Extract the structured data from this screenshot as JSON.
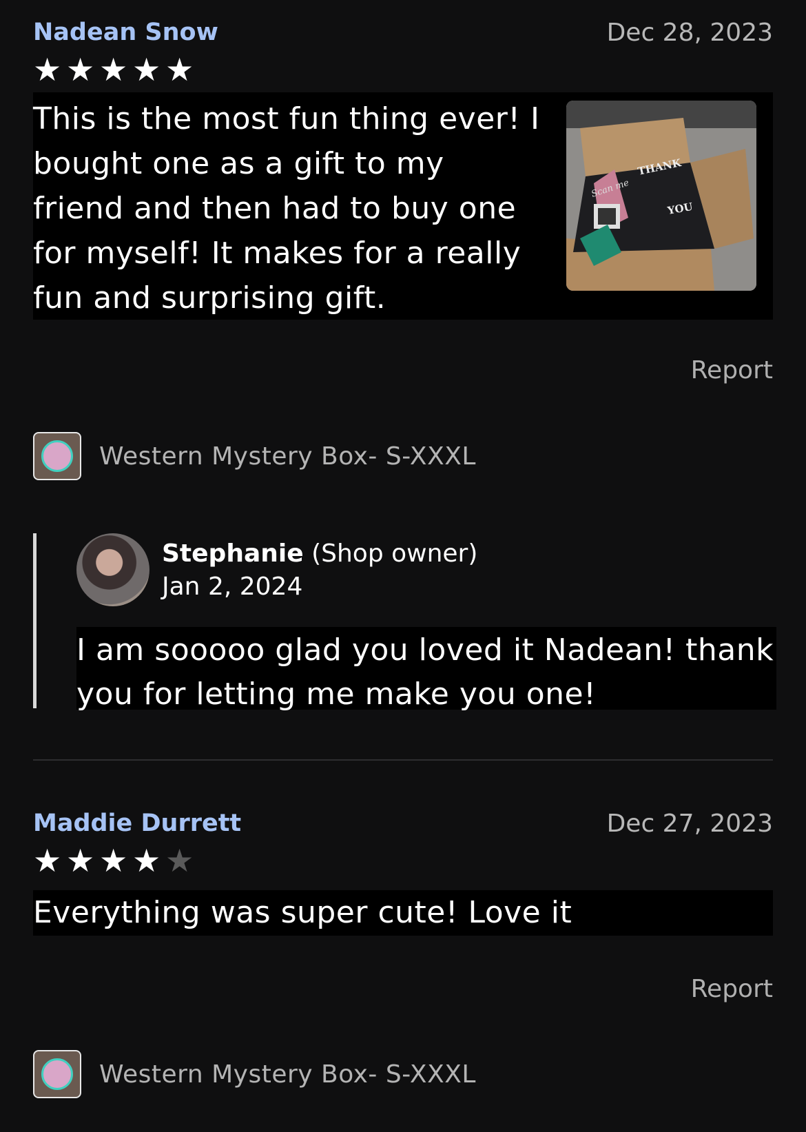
{
  "reviews": [
    {
      "reviewer": "Nadean Snow",
      "date": "Dec 28, 2023",
      "rating": 5,
      "text": "This is the most fun thing ever! I bought one as a gift to my friend and then had to buy one for myself! It makes for a really fun and surprising gift.",
      "report_label": "Report",
      "product_name": "Western Mystery Box- S-XXXL",
      "photo_text": {
        "line1": "THANK",
        "line2": "YOU",
        "scan": "Scan me"
      },
      "reply": {
        "owner_name": "Stephanie",
        "owner_role": "(Shop owner)",
        "date": "Jan 2, 2024",
        "text": "I am sooooo glad you loved it Nadean! thank you for letting me make you one!"
      }
    },
    {
      "reviewer": "Maddie Durrett",
      "date": "Dec 27, 2023",
      "rating": 4,
      "text": "Everything was super cute! Love it",
      "report_label": "Report",
      "product_name": "Western Mystery Box- S-XXXL"
    }
  ],
  "colors": {
    "reviewer_name": "#a6c3f5",
    "background": "#0f0f10",
    "text_block": "#000000"
  },
  "icons": {
    "star": "star-icon",
    "star_empty": "star-empty-icon"
  }
}
